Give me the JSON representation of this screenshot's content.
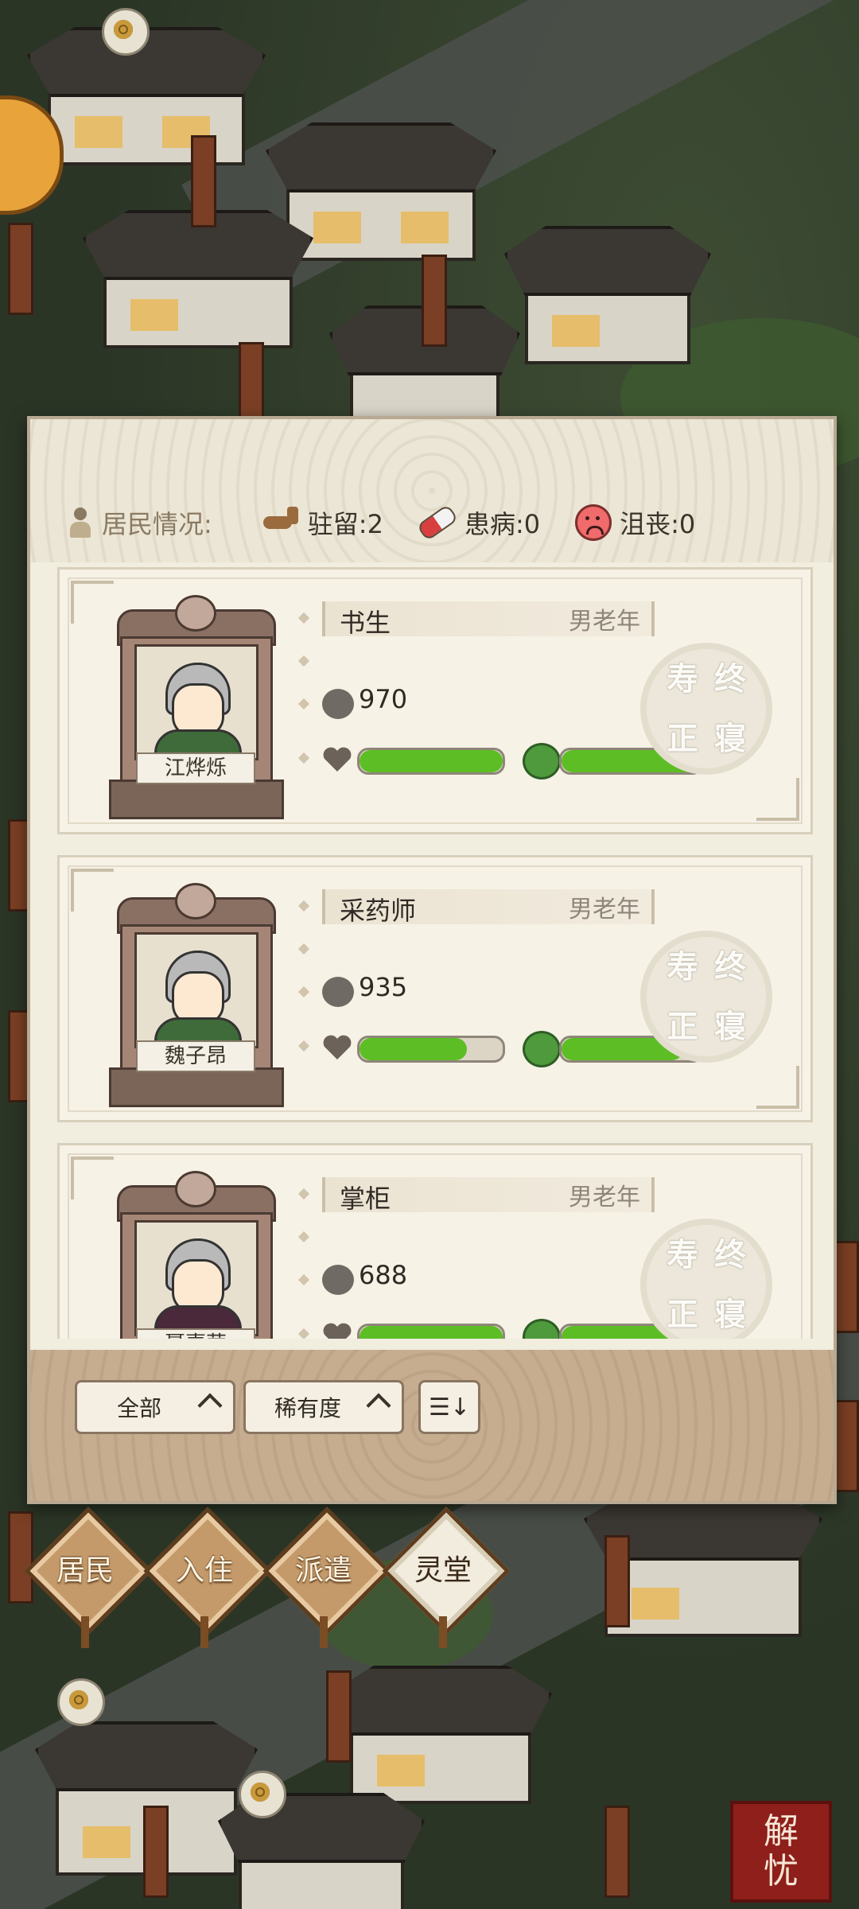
{
  "status": {
    "label": "居民情况:",
    "stationed": "驻留:2",
    "sick": "患病:0",
    "depressed": "沮丧:0"
  },
  "residents": [
    {
      "name": "江烨烁",
      "role": "书生",
      "age": "男老年",
      "score": "970",
      "health": 1.0,
      "mood": 1.0,
      "seal": [
        "寿",
        "终",
        "正",
        "寝"
      ],
      "outfit": "#3f6b3a"
    },
    {
      "name": "魏子昂",
      "role": "采药师",
      "age": "男老年",
      "score": "935",
      "health": 0.75,
      "mood": 0.87,
      "seal": [
        "寿",
        "终",
        "正",
        "寝"
      ],
      "outfit": "#3f6b3a"
    },
    {
      "name": "聂嘉荣",
      "role": "掌柜",
      "age": "男老年",
      "score": "688",
      "health": 1.0,
      "mood": 1.0,
      "seal": [
        "寿",
        "终",
        "正",
        "寝"
      ],
      "outfit": "#4a2a3a"
    }
  ],
  "filters": {
    "all": "全部",
    "rarity": "稀有度",
    "sort": "☰↓"
  },
  "nav": [
    {
      "label": "居民",
      "active": false
    },
    {
      "label": "入住",
      "active": false
    },
    {
      "label": "派遣",
      "active": false
    },
    {
      "label": "灵堂",
      "active": true
    }
  ],
  "corner_seal": [
    "解",
    "忧"
  ],
  "colors": {
    "bar_fill": "#5cbd24",
    "panel": "#f1eddf",
    "seal_red": "#8e1f1a"
  }
}
